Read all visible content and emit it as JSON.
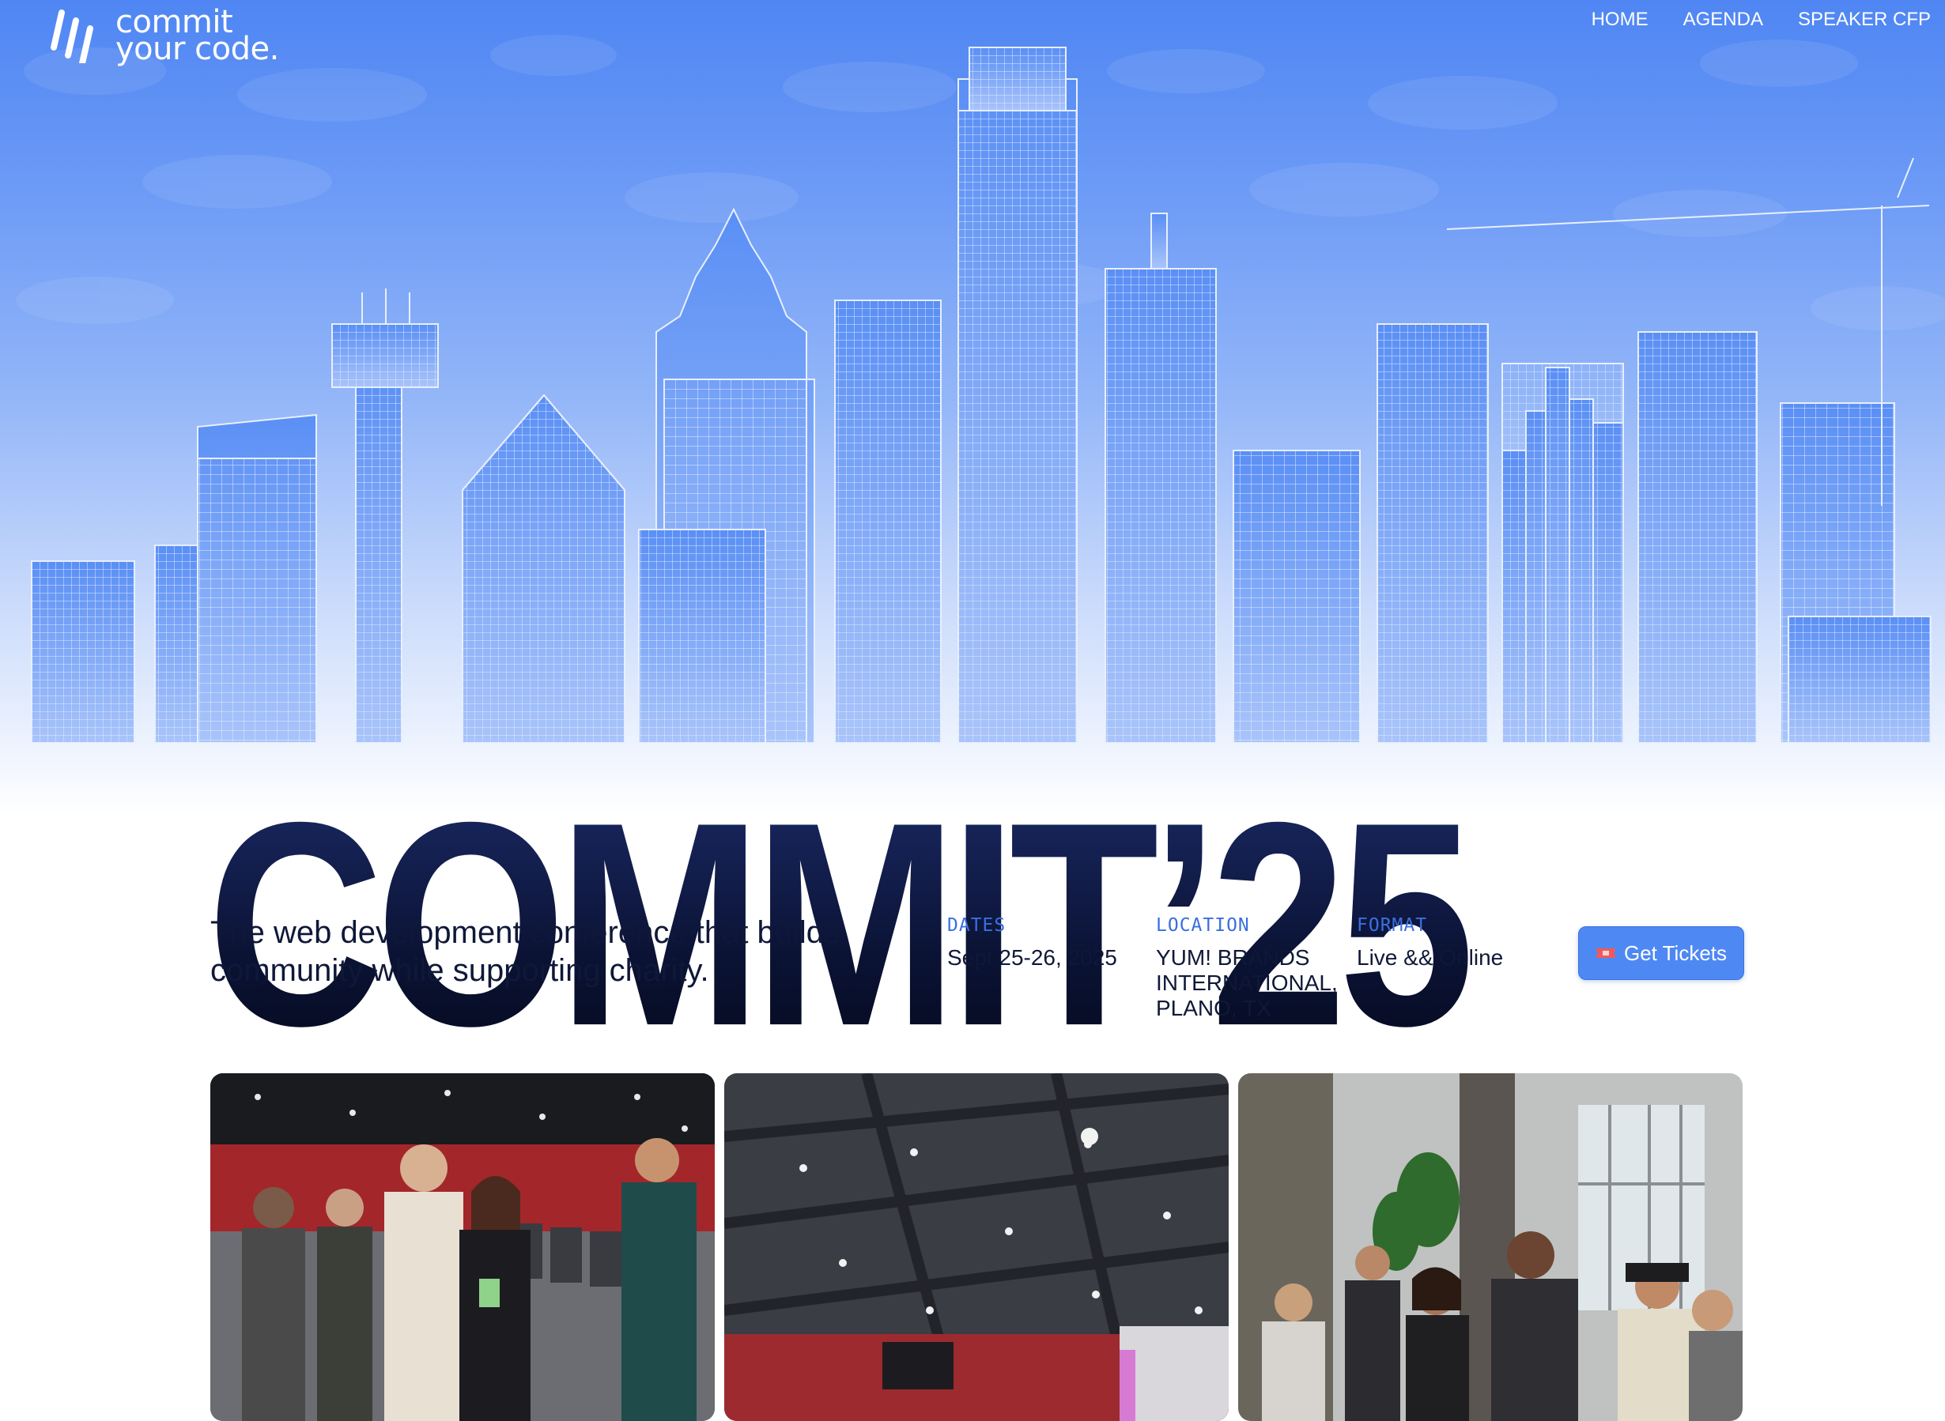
{
  "brand": {
    "logo_line1": "commit",
    "logo_line2": "your code."
  },
  "nav": [
    {
      "label": "HOME"
    },
    {
      "label": "AGENDA"
    },
    {
      "label": "SPEAKER CFP"
    }
  ],
  "hero": {
    "title": "COMMIT’25"
  },
  "intro": {
    "tagline": "The web development conference that builds community while supporting charity."
  },
  "details": {
    "dates": {
      "label": "DATES",
      "value": "Sept 25-26, 2025"
    },
    "location": {
      "label": "LOCATION",
      "value": "YUM! BRANDS INTERNATIONAL, PLANO, TX"
    },
    "format": {
      "label": "FORMAT",
      "value": "Live && Online"
    }
  },
  "cta": {
    "label": "Get Tickets",
    "icon": "ticket-icon"
  },
  "colors": {
    "accent": "#4e88f3",
    "title": "#0b1335",
    "sky": "#4f86f3"
  }
}
